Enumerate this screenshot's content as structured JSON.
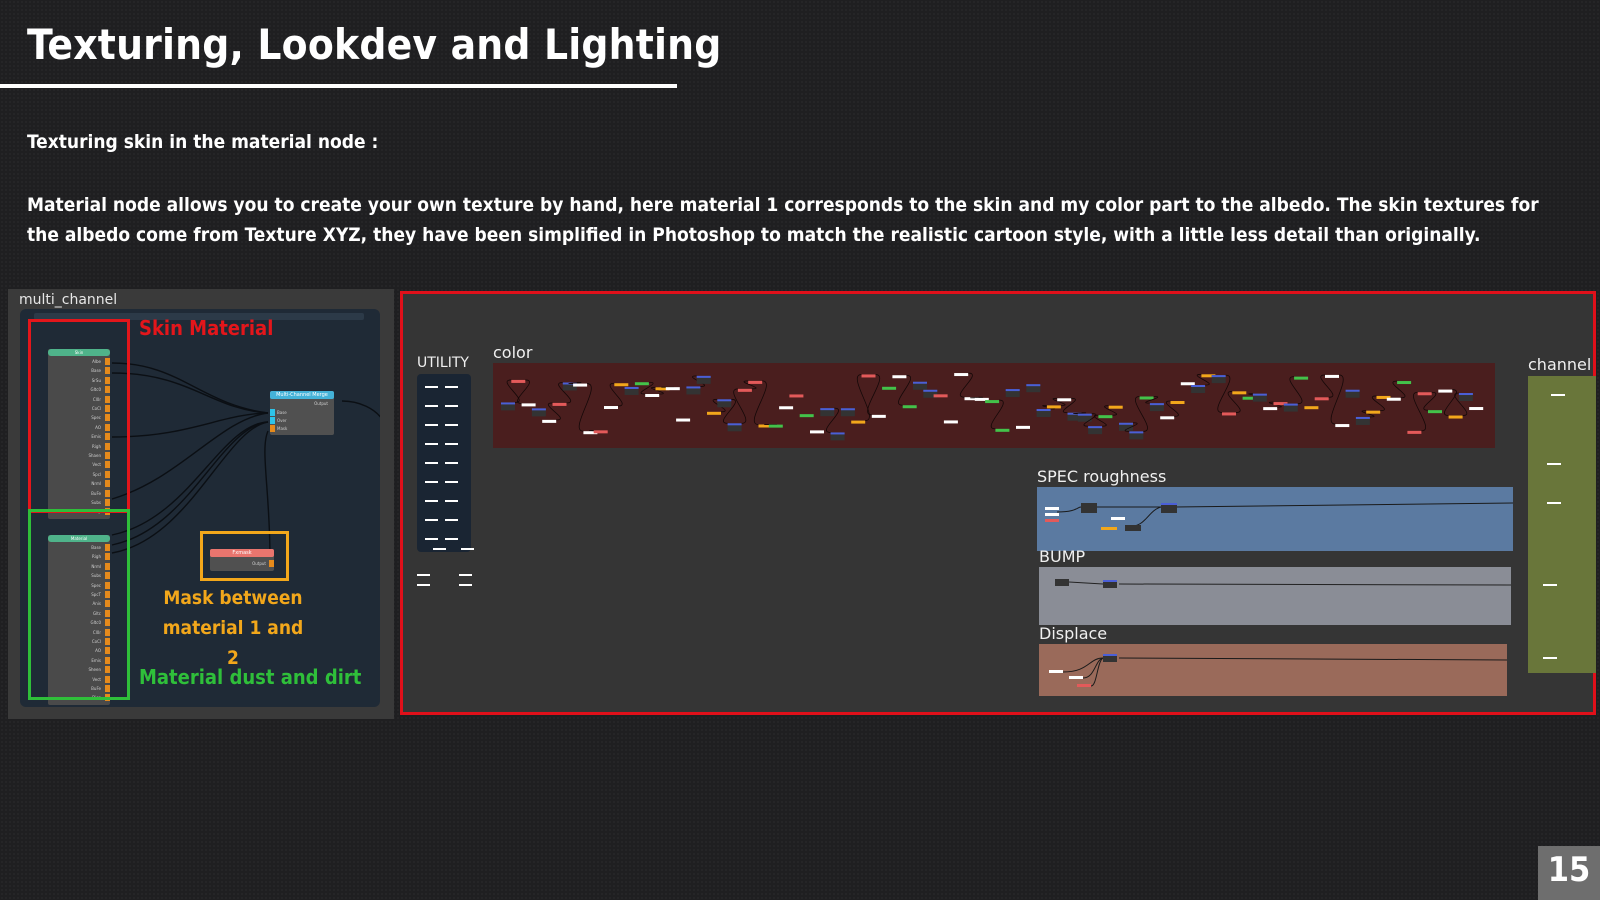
{
  "slide": {
    "title": "Texturing, Lookdev and Lighting",
    "subheading": "Texturing skin in the material node :",
    "body": "Material node allows you to create your own texture by hand, here material 1 corresponds to the skin and my color part to the albedo. The skin textures for the albedo come from Texture XYZ, they have been simplified in Photoshop to match the realistic cartoon style, with a little less detail than originally.",
    "page_number": "15"
  },
  "left_panel": {
    "label": "multi_channel",
    "annotations": {
      "skin": "Skin Material",
      "mask": "Mask between material 1 and 2",
      "dust": "Material dust and dirt"
    },
    "colors": {
      "skin": "#e3161b",
      "mask": "#f2a71b",
      "dust": "#2fbf3a"
    },
    "nodes": {
      "skin_header": "Skin",
      "skin_pins": [
        "Albe",
        "Base",
        "SrSu",
        "Gltc0",
        "Cl0r",
        "CoCl",
        "Spec",
        "AO",
        "Emis",
        "Righ",
        "Shaen",
        "Vect",
        "Spcl",
        "Nrml",
        "BuFe",
        "Subs",
        "Disp"
      ],
      "material_header": "Material",
      "material_pins": [
        "Base",
        "Righ",
        "Nrml",
        "Subs",
        "Spec",
        "SpcT",
        "Anis",
        "Gltc",
        "Gltc0",
        "Cl0r",
        "CoCl",
        "AO",
        "Emis",
        "Sheen",
        "Vect",
        "BuFe",
        "Disp"
      ],
      "merge_header": "Multi-Channel Merge",
      "merge_output": "Output",
      "merge_inputs": [
        "Base",
        "Over",
        "Mask"
      ],
      "fxmask_header": "Fxmask",
      "fxmask_output": "Output"
    }
  },
  "right_panel": {
    "backdrops": [
      {
        "label": "UTILITY",
        "color": "#1a2533"
      },
      {
        "label": "color",
        "color": "#4a1e1e"
      },
      {
        "label": "SPEC roughness",
        "color": "#5b7aa1"
      },
      {
        "label": "BUMP",
        "color": "#8a8d96"
      },
      {
        "label": "Displace",
        "color": "#9a6a5a"
      },
      {
        "label": "channel",
        "color": "#69763a"
      }
    ],
    "frame_color": "#e0101a"
  }
}
